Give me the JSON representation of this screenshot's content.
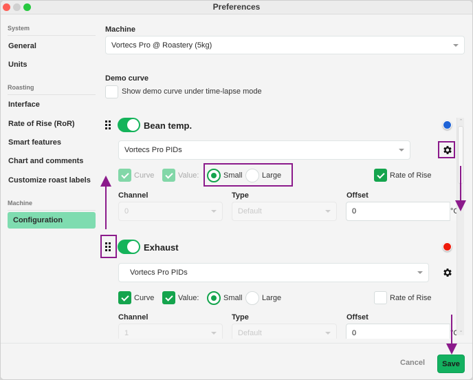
{
  "window": {
    "title": "Preferences"
  },
  "sidebar": {
    "sections": [
      {
        "label": "System",
        "items": [
          {
            "label": "General"
          },
          {
            "label": "Units"
          }
        ]
      },
      {
        "label": "Roasting",
        "items": [
          {
            "label": "Interface"
          },
          {
            "label": "Rate of Rise (RoR)"
          },
          {
            "label": "Smart features"
          },
          {
            "label": "Chart and comments"
          },
          {
            "label": "Customize roast labels"
          }
        ]
      },
      {
        "label": "Machine",
        "items": [
          {
            "label": "Configuration",
            "active": true
          }
        ]
      }
    ]
  },
  "main": {
    "machine": {
      "label": "Machine",
      "value": "Vortecs Pro @ Roastery (5kg)"
    },
    "demo_curve": {
      "label": "Demo curve",
      "checkbox_label": "Show demo curve under time-lapse mode",
      "checked": false
    },
    "curves": [
      {
        "title": "Bean temp.",
        "enabled": true,
        "color": "#1f63d6",
        "source": "Vortecs Pro PIDs",
        "curve_label": "Curve",
        "curve_checked": true,
        "value_label": "Value:",
        "value_checked": true,
        "size_small": "Small",
        "size_large": "Large",
        "size_selected": "Small",
        "ror_label": "Rate of Rise",
        "ror_checked": true,
        "channel_label": "Channel",
        "channel_value": "0",
        "type_label": "Type",
        "type_value": "Default",
        "offset_label": "Offset",
        "offset_value": "0",
        "offset_unit": "°C"
      },
      {
        "title": "Exhaust",
        "enabled": true,
        "color": "#ee1b0b",
        "source": "Vortecs Pro PIDs",
        "curve_label": "Curve",
        "curve_checked": true,
        "value_label": "Value:",
        "value_checked": true,
        "size_small": "Small",
        "size_large": "Large",
        "size_selected": "Small",
        "ror_label": "Rate of Rise",
        "ror_checked": false,
        "channel_label": "Channel",
        "channel_value": "1",
        "type_label": "Type",
        "type_value": "Default",
        "offset_label": "Offset",
        "offset_value": "0",
        "offset_unit": "°C"
      }
    ]
  },
  "footer": {
    "cancel_label": "Cancel",
    "save_label": "Save"
  },
  "colors": {
    "accent": "#14b35a",
    "active_nav": "#7fdcb0",
    "annotation": "#8b1a8b"
  }
}
